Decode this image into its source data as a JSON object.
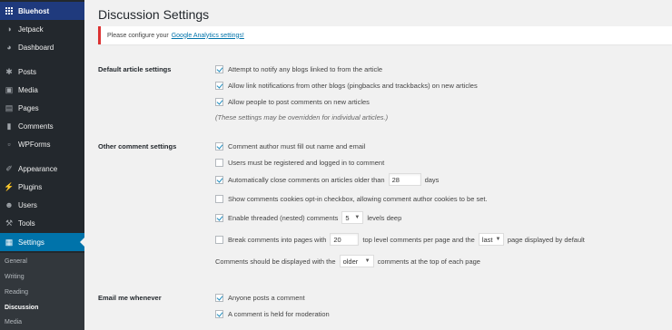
{
  "sidebar": {
    "items": [
      {
        "label": "Bluehost",
        "icon": "grid-icon"
      },
      {
        "label": "Jetpack",
        "icon": "jetpack-icon"
      },
      {
        "label": "Dashboard",
        "icon": "dashboard-icon"
      },
      {
        "label": "Posts",
        "icon": "pin-icon"
      },
      {
        "label": "Media",
        "icon": "media-icon"
      },
      {
        "label": "Pages",
        "icon": "pages-icon"
      },
      {
        "label": "Comments",
        "icon": "comments-icon"
      },
      {
        "label": "WPForms",
        "icon": "wpforms-icon"
      },
      {
        "label": "Appearance",
        "icon": "brush-icon"
      },
      {
        "label": "Plugins",
        "icon": "plugin-icon"
      },
      {
        "label": "Users",
        "icon": "users-icon"
      },
      {
        "label": "Tools",
        "icon": "wrench-icon"
      },
      {
        "label": "Settings",
        "icon": "settings-icon"
      }
    ],
    "submenu": [
      "General",
      "Writing",
      "Reading",
      "Discussion",
      "Media"
    ]
  },
  "page": {
    "title": "Discussion Settings",
    "notice_text": "Please configure your",
    "notice_link": "Google Analytics settings!"
  },
  "sections": {
    "default_article": {
      "label": "Default article settings",
      "options": [
        {
          "label": "Attempt to notify any blogs linked to from the article",
          "checked": true
        },
        {
          "label": "Allow link notifications from other blogs (pingbacks and trackbacks) on new articles",
          "checked": true
        },
        {
          "label": "Allow people to post comments on new articles",
          "checked": true
        }
      ],
      "note": "(These settings may be overridden for individual articles.)"
    },
    "other_comment": {
      "label": "Other comment settings",
      "author_info": "Comment author must fill out name and email",
      "registered": "Users must be registered and logged in to comment",
      "auto_close_pre": "Automatically close comments on articles older than",
      "auto_close_days": "28",
      "auto_close_post": "days",
      "cookies": "Show comments cookies opt-in checkbox, allowing comment author cookies to be set.",
      "threaded_pre": "Enable threaded (nested) comments",
      "threaded_depth": "5",
      "threaded_post": "levels deep",
      "paged_pre": "Break comments into pages with",
      "paged_count": "20",
      "paged_mid": "top level comments per page and the",
      "paged_select": "last",
      "paged_post": "page displayed by default",
      "order_pre": "Comments should be displayed with the",
      "order_select": "older",
      "order_post": "comments at the top of each page"
    },
    "email": {
      "label": "Email me whenever",
      "options": [
        {
          "label": "Anyone posts a comment",
          "checked": true
        },
        {
          "label": "A comment is held for moderation",
          "checked": true
        }
      ]
    }
  },
  "colors": {
    "sidebar_bg": "#23282d",
    "active": "#0073aa",
    "notice_border": "#dc3232",
    "link": "#0073aa"
  }
}
